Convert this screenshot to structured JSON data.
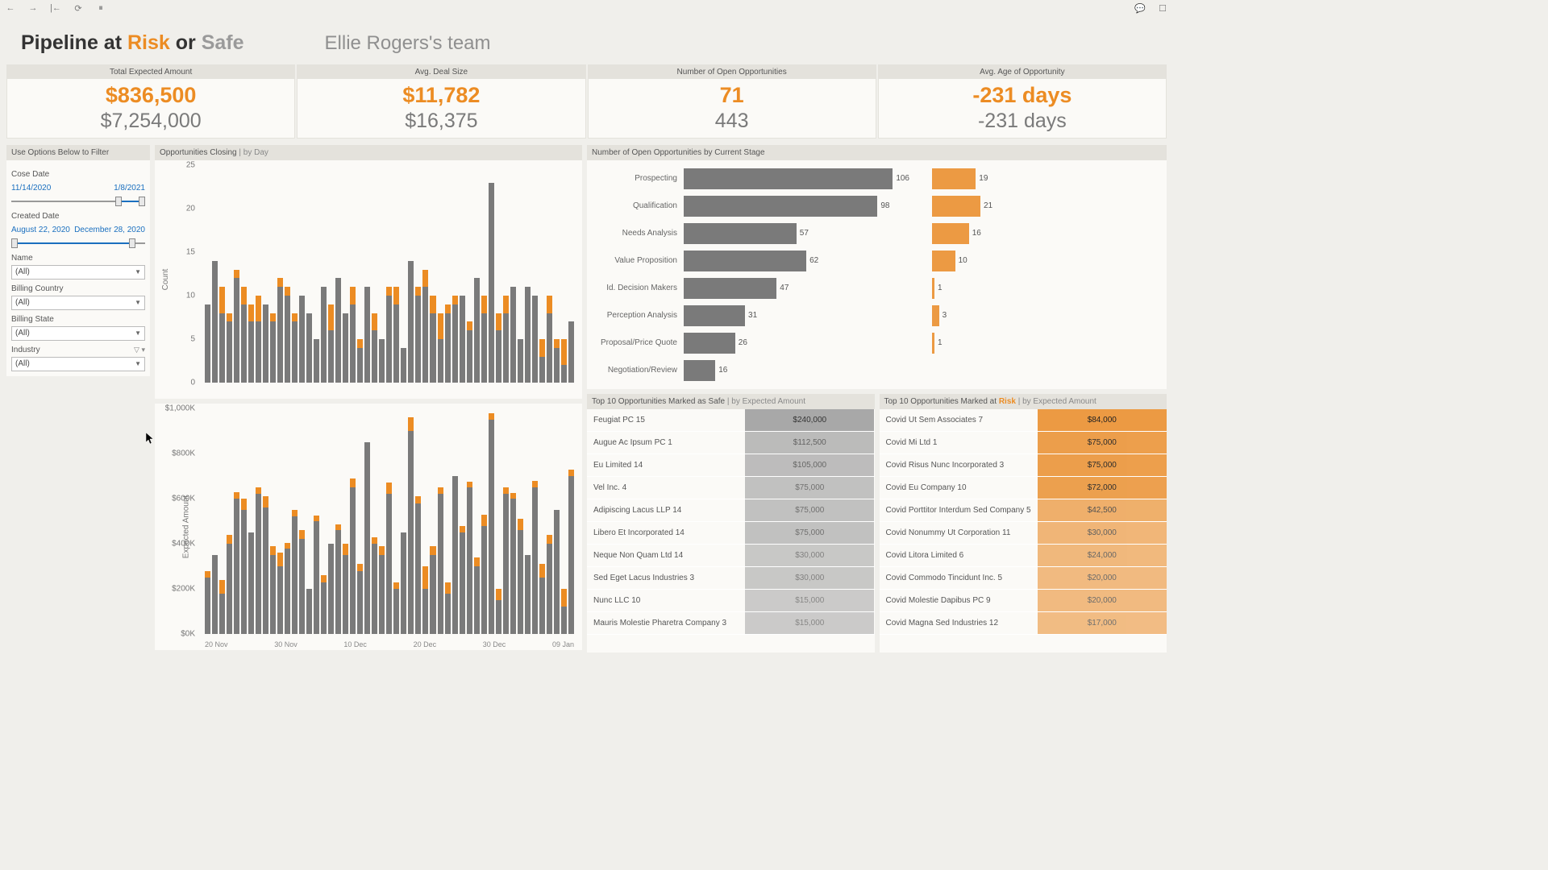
{
  "title": {
    "prefix": "Pipeline at ",
    "risk": "Risk",
    "middle": " or ",
    "safe": "Safe"
  },
  "team": "Ellie Rogers's team",
  "kpis": [
    {
      "label": "Total Expected Amount",
      "v1": "$836,500",
      "v2": "$7,254,000"
    },
    {
      "label": "Avg. Deal Size",
      "v1": "$11,782",
      "v2": "$16,375"
    },
    {
      "label": "Number of Open Opportunities",
      "v1": "71",
      "v2": "443"
    },
    {
      "label": "Avg. Age of Opportunity",
      "v1": "-231 days",
      "v2": "-231 days"
    }
  ],
  "filters": {
    "panel_title": "Use Options Below to Filter",
    "close_date": {
      "label": "Cose Date",
      "from": "11/14/2020",
      "to": "1/8/2021"
    },
    "created_date": {
      "label": "Created Date",
      "from": "August 22, 2020",
      "to": "December 28, 2020"
    },
    "name": {
      "label": "Name",
      "value": "(All)"
    },
    "billing_country": {
      "label": "Billing Country",
      "value": "(All)"
    },
    "billing_state": {
      "label": "Billing State",
      "value": "(All)"
    },
    "industry": {
      "label": "Industry",
      "value": "(All)"
    }
  },
  "chart_count": {
    "title": "Opportunities Closing ",
    "sub": "| by Day",
    "ylabel": "Count"
  },
  "chart_amount": {
    "ylabel": "Expected Amount"
  },
  "stages": {
    "title": "Number of Open Opportunities by Current Stage"
  },
  "safe_table": {
    "title": "Top 10 Opportunities Marked as Safe ",
    "sub": "| by Expected Amount",
    "rows": [
      {
        "n": "Feugiat PC 15",
        "a": "$240,000"
      },
      {
        "n": "Augue Ac Ipsum PC 1",
        "a": "$112,500"
      },
      {
        "n": "Eu Limited 14",
        "a": "$105,000"
      },
      {
        "n": "Vel Inc. 4",
        "a": "$75,000"
      },
      {
        "n": "Adipiscing Lacus LLP 14",
        "a": "$75,000"
      },
      {
        "n": "Libero Et Incorporated 14",
        "a": "$75,000"
      },
      {
        "n": "Neque Non Quam Ltd 14",
        "a": "$30,000"
      },
      {
        "n": "Sed Eget Lacus Industries 3",
        "a": "$30,000"
      },
      {
        "n": "Nunc LLC 10",
        "a": "$15,000"
      },
      {
        "n": "Mauris Molestie Pharetra Company 3",
        "a": "$15,000"
      }
    ]
  },
  "risk_table": {
    "title_pre": "Top 10 Opportunities Marked at ",
    "title_risk": "Risk ",
    "sub": "| by Expected Amount",
    "rows": [
      {
        "n": "Covid Ut Sem Associates 7",
        "a": "$84,000"
      },
      {
        "n": "Covid Mi Ltd 1",
        "a": "$75,000"
      },
      {
        "n": "Covid Risus Nunc Incorporated 3",
        "a": "$75,000"
      },
      {
        "n": "Covid Eu Company 10",
        "a": "$72,000"
      },
      {
        "n": "Covid Porttitor Interdum Sed Company 5",
        "a": "$42,500"
      },
      {
        "n": "Covid Nonummy Ut Corporation 11",
        "a": "$30,000"
      },
      {
        "n": "Covid Litora Limited 6",
        "a": "$24,000"
      },
      {
        "n": "Covid Commodo Tincidunt Inc. 5",
        "a": "$20,000"
      },
      {
        "n": "Covid Molestie Dapibus PC 9",
        "a": "$20,000"
      },
      {
        "n": "Covid Magna Sed Industries 12",
        "a": "$17,000"
      }
    ]
  },
  "chart_data": [
    {
      "type": "bar",
      "title": "Opportunities Closing | by Day",
      "ylabel": "Count",
      "ylim": [
        0,
        25
      ],
      "x_ticks": [
        "20 Nov",
        "30 Nov",
        "10 Dec",
        "20 Dec",
        "30 Dec",
        "09 Jan"
      ],
      "series": [
        {
          "name": "Safe",
          "color": "#7a7a7a",
          "values": [
            9,
            14,
            8,
            7,
            12,
            9,
            7,
            7,
            9,
            7,
            11,
            10,
            7,
            10,
            8,
            5,
            11,
            6,
            12,
            8,
            9,
            4,
            11,
            6,
            5,
            10,
            9,
            4,
            14,
            10,
            11,
            8,
            5,
            8,
            9,
            10,
            6,
            12,
            8,
            23,
            6,
            8,
            11,
            5,
            11,
            10,
            3,
            8,
            4,
            2,
            7
          ]
        },
        {
          "name": "Risk",
          "color": "#ec8c23",
          "values": [
            0,
            0,
            3,
            1,
            1,
            2,
            2,
            3,
            0,
            1,
            1,
            1,
            1,
            0,
            0,
            0,
            0,
            3,
            0,
            0,
            2,
            1,
            0,
            2,
            0,
            1,
            2,
            0,
            0,
            1,
            2,
            2,
            3,
            1,
            1,
            0,
            1,
            0,
            2,
            0,
            2,
            2,
            0,
            0,
            0,
            0,
            2,
            2,
            1,
            3,
            0
          ]
        }
      ]
    },
    {
      "type": "bar",
      "title": "Opportunities Closing | by Day (Expected Amount)",
      "ylabel": "Expected Amount",
      "ylim": [
        0,
        1000000
      ],
      "x_ticks": [
        "20 Nov",
        "30 Nov",
        "10 Dec",
        "20 Dec",
        "30 Dec",
        "09 Jan"
      ],
      "series": [
        {
          "name": "Safe",
          "color": "#7a7a7a",
          "values": [
            250,
            350,
            180,
            400,
            600,
            550,
            450,
            620,
            560,
            350,
            300,
            380,
            520,
            420,
            200,
            500,
            230,
            400,
            460,
            350,
            650,
            280,
            850,
            400,
            350,
            620,
            200,
            450,
            900,
            580,
            200,
            350,
            620,
            180,
            700,
            450,
            650,
            300,
            480,
            950,
            150,
            620,
            600,
            460,
            350,
            650,
            250,
            400,
            550,
            120,
            700
          ]
        },
        {
          "name": "Risk",
          "color": "#ec8c23",
          "values": [
            30,
            0,
            60,
            40,
            30,
            50,
            0,
            30,
            50,
            40,
            60,
            25,
            30,
            40,
            0,
            25,
            30,
            0,
            25,
            50,
            40,
            30,
            0,
            30,
            40,
            50,
            30,
            0,
            60,
            30,
            100,
            40,
            30,
            50,
            0,
            30,
            25,
            40,
            50,
            30,
            50,
            30,
            25,
            50,
            0,
            30,
            60,
            40,
            0,
            80,
            30
          ]
        }
      ]
    },
    {
      "type": "bar",
      "title": "Number of Open Opportunities by Current Stage",
      "xlabel": "",
      "ylabel": "",
      "categories": [
        "Prospecting",
        "Qualification",
        "Needs Analysis",
        "Value Proposition",
        "Id. Decision Makers",
        "Perception Analysis",
        "Proposal/Price Quote",
        "Negotiation/Review"
      ],
      "series": [
        {
          "name": "Safe",
          "color": "#7a7a7a",
          "values": [
            106,
            98,
            57,
            62,
            47,
            31,
            26,
            16
          ]
        },
        {
          "name": "Risk",
          "color": "#ec9a43",
          "values": [
            19,
            21,
            16,
            10,
            1,
            3,
            1,
            0
          ]
        }
      ]
    }
  ]
}
